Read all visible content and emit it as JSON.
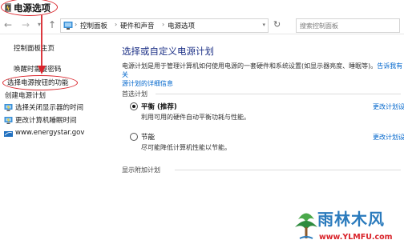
{
  "window": {
    "title": "电源选项"
  },
  "navbar": {
    "breadcrumbs": [
      "控制面板",
      "硬件和声音",
      "电源选项"
    ],
    "search_placeholder": "搜索控制面板"
  },
  "sidebar": {
    "links": [
      "控制面板主页",
      "唤醒时需要密码",
      "选择电源按钮的功能",
      "创建电源计划"
    ],
    "items": [
      {
        "label": "选择关闭显示器的时间",
        "icon": "power-settings-icon"
      },
      {
        "label": "更改计算机睡眠时间",
        "icon": "power-settings-icon"
      },
      {
        "label": "www.energystar.gov",
        "icon": "energystar-icon"
      }
    ]
  },
  "main": {
    "title": "选择或自定义电源计划",
    "desc_text": "电源计划是用于管理计算机如何使用电源的一套硬件和系统设置(如显示器亮度、睡眠等)。",
    "desc_link_a": "告诉我有关",
    "desc_link_b": "源计划的详细信息",
    "preferred_section": "首选计划",
    "plans": [
      {
        "name": "平衡 (推荐)",
        "desc": "利用可用的硬件自动平衡功耗与性能。",
        "link": "更改计划设",
        "selected": true
      },
      {
        "name": "节能",
        "desc": "尽可能降低计算机性能以节能。",
        "link": "更改计划设",
        "selected": false
      }
    ],
    "extra_section": "显示附加计划"
  },
  "watermark": {
    "text_cn": "雨林木风",
    "url": "www.YLMFU.com"
  },
  "colors": {
    "annotation": "#d9232a",
    "link": "#0066cc",
    "title": "#1e3287",
    "watermark": "#2b7bbd"
  }
}
